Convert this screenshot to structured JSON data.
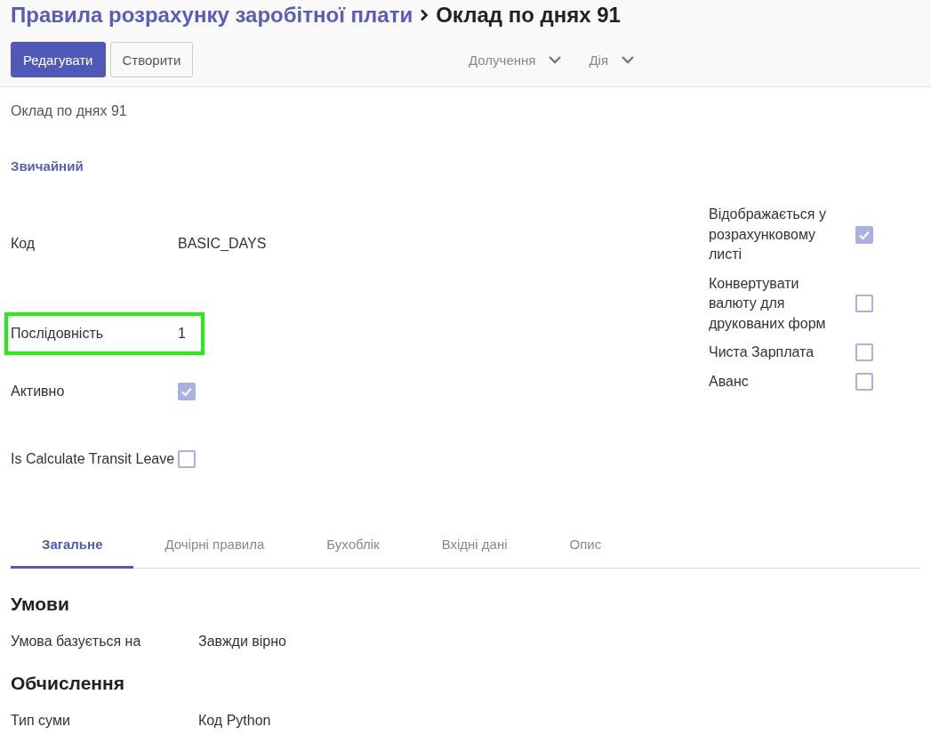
{
  "breadcrumb": {
    "parent": "Правила розрахунку заробітної плати",
    "current": "Оклад по днях 91"
  },
  "buttons": [
    {
      "label": "Редагувати",
      "kind": "primary"
    },
    {
      "label": "Створити",
      "kind": "secondary"
    }
  ],
  "menus": [
    {
      "label": "Долучення"
    },
    {
      "label": "Дія"
    }
  ],
  "record_name": "Оклад по днях 91",
  "category": "Звичайний",
  "left_fields": [
    {
      "label": "Код",
      "kind": "text",
      "value": "BASIC_DAYS",
      "highlighted": false
    },
    {
      "label": "Послідовність",
      "kind": "text",
      "value": "1",
      "highlighted": true
    },
    {
      "label": "Активно",
      "kind": "checkbox",
      "checked": true,
      "highlighted": false
    },
    {
      "label": "Is Calculate Transit Leave",
      "kind": "checkbox",
      "checked": false,
      "highlighted": false
    }
  ],
  "right_fields": [
    {
      "label": "Відображається у розрахунковому листі",
      "checked": true
    },
    {
      "label": "Конвертувати валюту для друкованих форм",
      "checked": false
    },
    {
      "label": "Чиста Зарплата",
      "checked": false
    },
    {
      "label": "Аванс",
      "checked": false
    }
  ],
  "tabs": [
    {
      "label": "Загальне",
      "selected": true
    },
    {
      "label": "Дочірні правила",
      "selected": false
    },
    {
      "label": "Бухоблік",
      "selected": false
    },
    {
      "label": "Вхідні дані",
      "selected": false
    },
    {
      "label": "Опис",
      "selected": false
    }
  ],
  "sections": [
    {
      "title": "Умови",
      "fields": [
        {
          "label": "Умова базується на",
          "value": "Завжди вірно"
        }
      ]
    },
    {
      "title": "Обчислення",
      "fields": [
        {
          "label": "Тип суми",
          "value": "Код Python"
        }
      ]
    }
  ]
}
